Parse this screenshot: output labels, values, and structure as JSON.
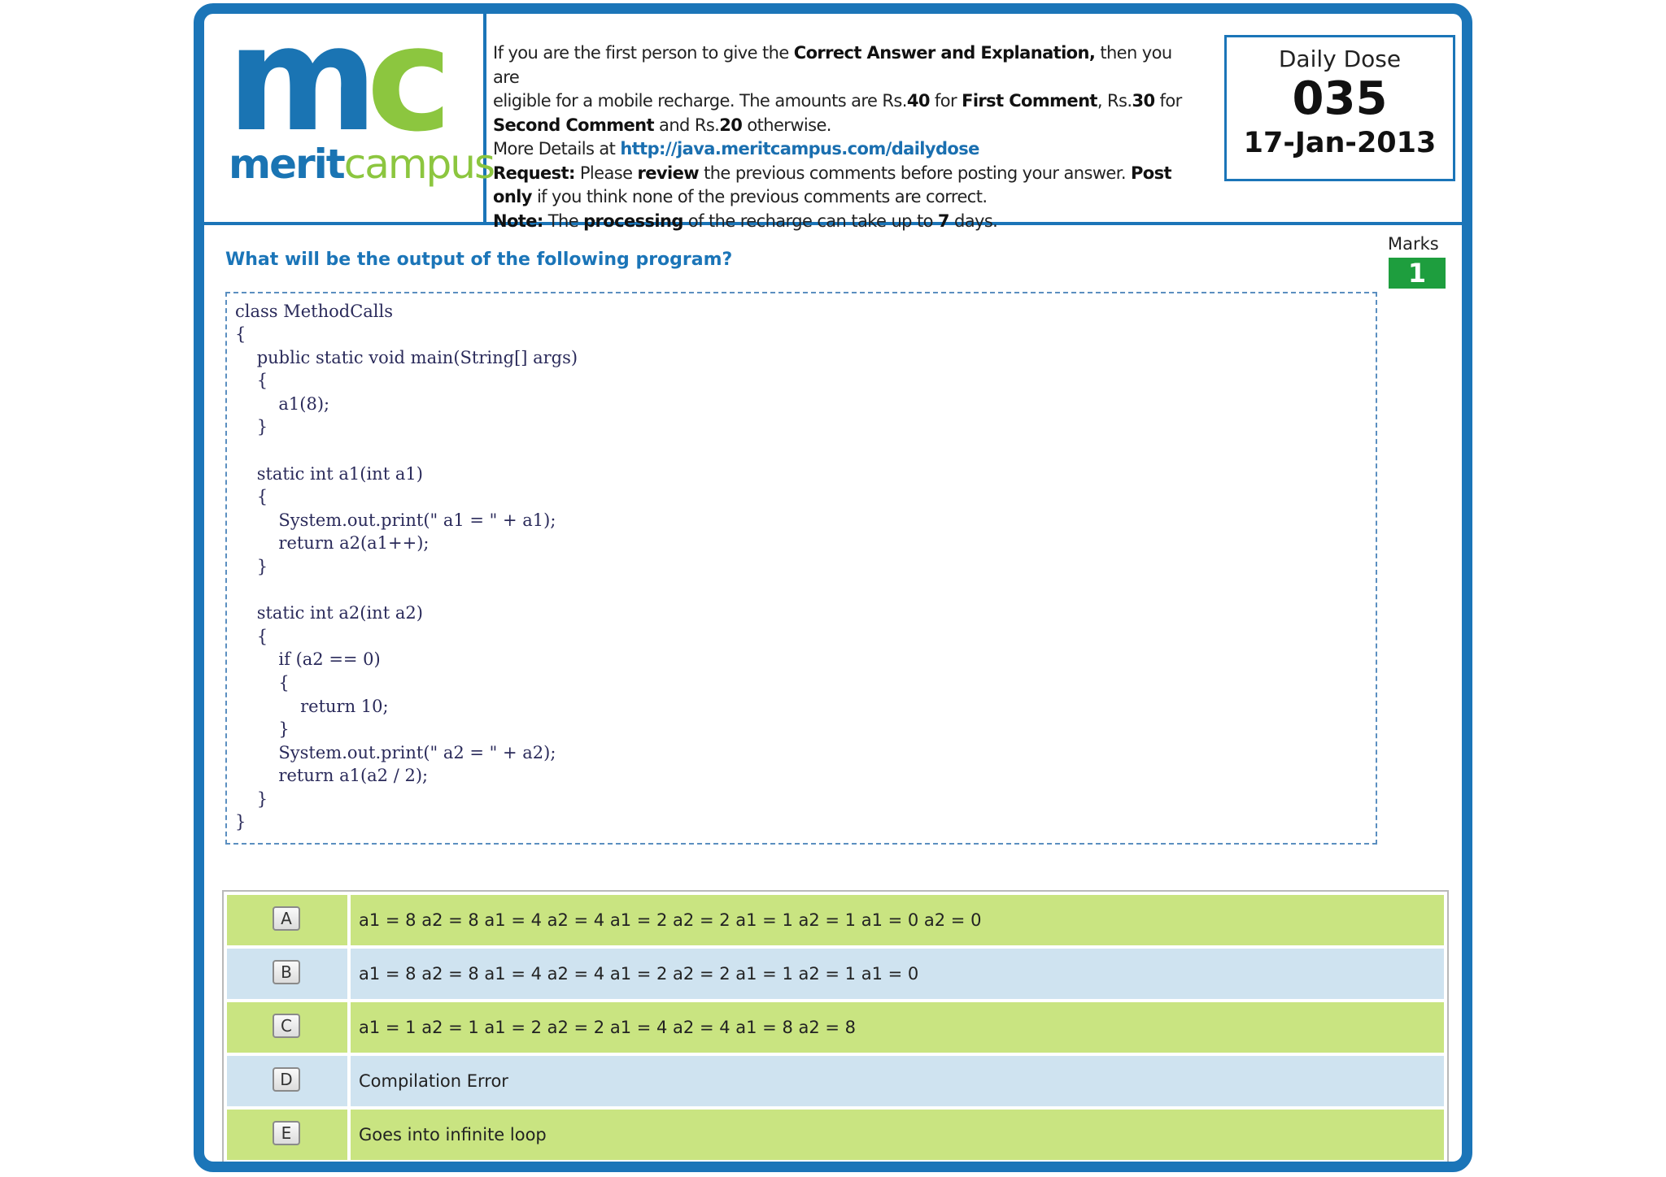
{
  "logo": {
    "mark_m": "m",
    "mark_c": "c",
    "word_merit": "merit",
    "word_campus": "campus"
  },
  "info": {
    "l1a": "If you are the first person to give the ",
    "l1b": "Correct Answer and Explanation,",
    "l1c": " then you are",
    "l2a": "eligible for a mobile recharge. The amounts are Rs.",
    "l2b": "40",
    "l2c": " for ",
    "l2d": "First Comment",
    "l2e": ", Rs.",
    "l2f": "30",
    "l2g": " for",
    "l3a": "Second Comment",
    "l3b": " and Rs.",
    "l3c": "20",
    "l3d": " otherwise.",
    "l4a": "More Details at ",
    "l4link": "http://java.meritcampus.com/dailydose",
    "l5a": "Request:",
    "l5b": "  Please ",
    "l5c": "review",
    "l5d": " the previous comments before posting your answer.  ",
    "l5e": "Post",
    "l6a": "only",
    "l6b": " if you think none of the previous comments are correct.",
    "l7a": "Note:",
    "l7b": " The ",
    "l7c": "processing",
    "l7d": " of the recharge can take up to ",
    "l7e": "7",
    "l7f": " days."
  },
  "daily_dose": {
    "title": "Daily Dose",
    "number": "035",
    "date": "17-Jan-2013"
  },
  "question": "What will be the output of the following program?",
  "marks": {
    "label": "Marks",
    "value": "1"
  },
  "code_lines": [
    "class MethodCalls",
    "{",
    "    public static void main(String[] args)",
    "    {",
    "        a1(8);",
    "    }",
    "",
    "    static int a1(int a1)",
    "    {",
    "        System.out.print(\" a1 = \" + a1);",
    "        return a2(a1++);",
    "    }",
    "",
    "    static int a2(int a2)",
    "    {",
    "        if (a2 == 0)",
    "        {",
    "            return 10;",
    "        }",
    "        System.out.print(\" a2 = \" + a2);",
    "        return a1(a2 / 2);",
    "    }",
    "}"
  ],
  "options": [
    {
      "letter": "A",
      "text": "a1 = 8 a2 = 8 a1 = 4 a2 = 4 a1 = 2 a2 = 2 a1 = 1 a2 = 1 a1 = 0 a2 = 0"
    },
    {
      "letter": "B",
      "text": "a1 = 8 a2 = 8 a1 = 4 a2 = 4 a1 = 2 a2 = 2 a1 = 1 a2 = 1 a1 = 0"
    },
    {
      "letter": "C",
      "text": "a1 = 1 a2 = 1 a1 = 2 a2 = 2 a1 = 4 a2 = 4 a1 = 8 a2 = 8"
    },
    {
      "letter": "D",
      "text": "Compilation Error"
    },
    {
      "letter": "E",
      "text": "Goes into infinite loop"
    }
  ],
  "colors": {
    "frame": "#1b75b8",
    "row_green": "#c9e481",
    "row_blue": "#cfe3f0",
    "marks_bg": "#1e9e3e"
  }
}
